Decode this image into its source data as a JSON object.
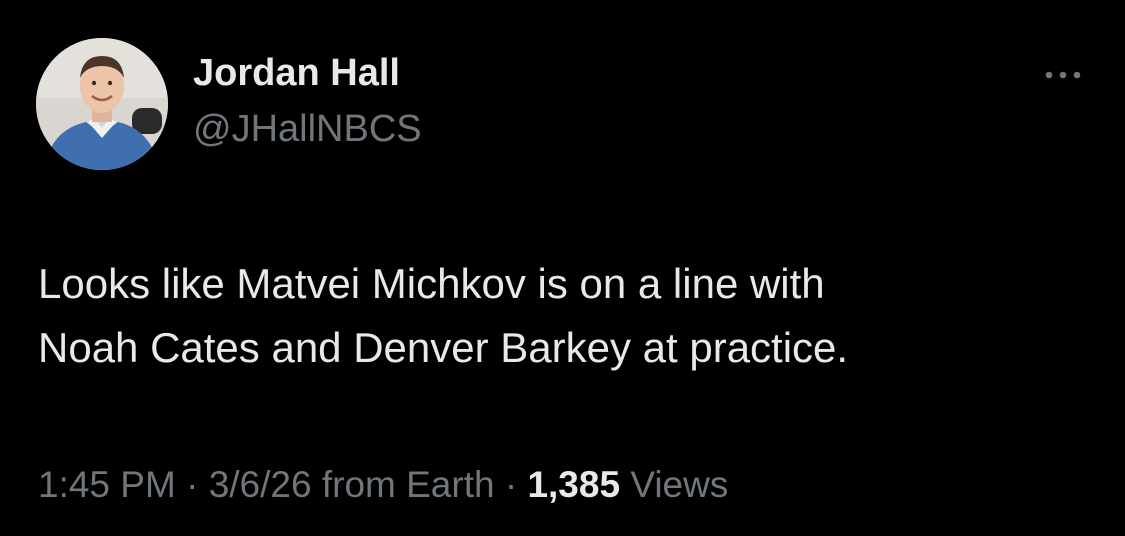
{
  "author": {
    "display_name": "Jordan Hall",
    "handle": "@JHallNBCS"
  },
  "tweet": {
    "text_lines": [
      "Looks like Matvei Michkov is on a line with",
      "Noah Cates and Denver Barkey at practice."
    ]
  },
  "meta": {
    "time": "1:45 PM",
    "separator": " · ",
    "date": "3/6/26",
    "source": "from Earth",
    "views_count": "1,385",
    "views_label": "Views"
  },
  "icons": {
    "more": "more-horizontal-icon"
  },
  "colors": {
    "background": "#000000",
    "primary_text": "#e7e9ea",
    "secondary_text": "#71767b"
  }
}
